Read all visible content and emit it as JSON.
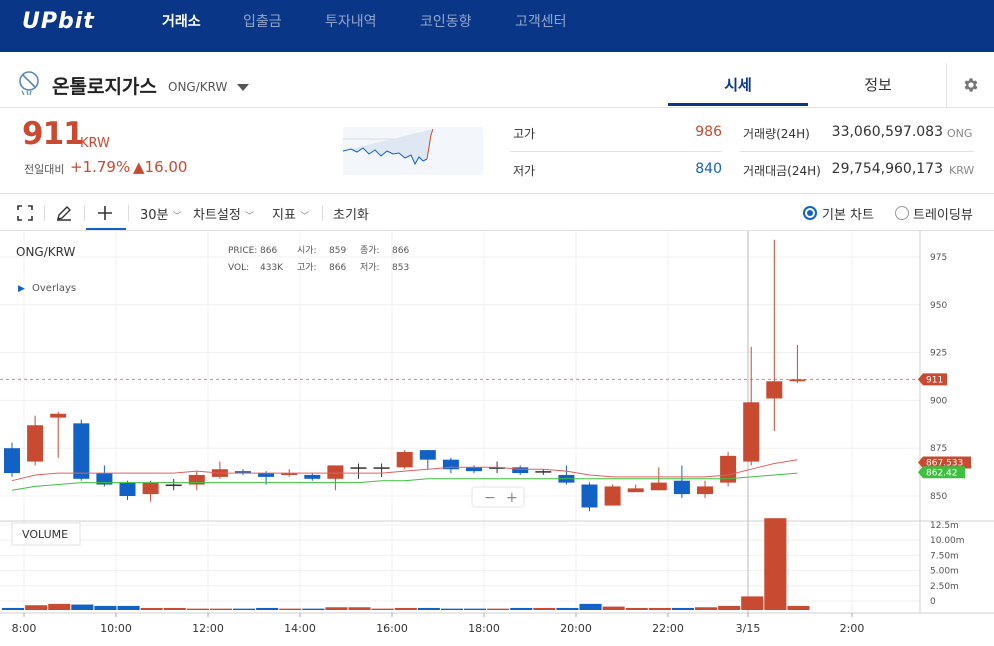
{
  "nav": {
    "logo": "UPbit",
    "items": [
      "거래소",
      "입출금",
      "투자내역",
      "코인동향",
      "고객센터"
    ]
  },
  "coin": {
    "name": "온톨로지가스",
    "pair": "ONG/KRW"
  },
  "tabs": [
    "시세",
    "정보"
  ],
  "price": {
    "current": "911",
    "unit": "KRW",
    "change_label": "전일대비",
    "change_pct": "+1.79%",
    "change_amt": "▲16.00"
  },
  "stats": {
    "high_label": "고가",
    "high_value": "986",
    "low_label": "저가",
    "low_value": "840",
    "volume_label": "거래량(24H)",
    "volume_value": "33,060,597.083",
    "volume_unit": "ONG",
    "amount_label": "거래대금(24H)",
    "amount_value": "29,754,960,173",
    "amount_unit": "KRW"
  },
  "toolbar": {
    "interval": "30분",
    "chart_settings": "차트설정",
    "indicators": "지표",
    "reset": "초기화",
    "basic_chart": "기본 차트",
    "tradingview": "트레이딩뷰"
  },
  "chart_info": {
    "symbol": "ONG/KRW",
    "overlays": "Overlays",
    "price_label": "PRICE:",
    "price_val": "866",
    "open_label": "시가:",
    "open_val": "859",
    "close_label": "종가:",
    "close_val": "866",
    "vol_label": "VOL:",
    "vol_val": "433K",
    "high_label": "고가:",
    "high_val": "866",
    "low_label": "저가:",
    "low_val": "853",
    "volume_panel": "VOLUME",
    "zoom_out": "−",
    "zoom_in": "+"
  },
  "colors": {
    "nav_bg": "#093687",
    "up": "#c84a31",
    "down": "#1261c4",
    "ma_fast": "#e06060",
    "ma_slow": "#3fbf3f"
  },
  "chart_data": {
    "type": "candlestick",
    "x_ticks": [
      "8:00",
      "10:00",
      "12:00",
      "14:00",
      "16:00",
      "18:00",
      "20:00",
      "22:00",
      "3/15",
      "2:00"
    ],
    "y_ticks": [
      975,
      950,
      925,
      900,
      875,
      850
    ],
    "vol_ticks": [
      "12.5m",
      "10.00m",
      "7.50m",
      "5.00m",
      "2.50m",
      "0"
    ],
    "price_tags": [
      {
        "label": "911",
        "value": 911,
        "color": "#c84a31"
      },
      {
        "label": "867.533",
        "value": 867.5,
        "color": "#c84a31"
      },
      {
        "label": "862.42",
        "value": 862.4,
        "color": "#3fbf3f"
      }
    ],
    "candles": [
      {
        "o": 875,
        "c": 862,
        "h": 878,
        "l": 860
      },
      {
        "o": 868,
        "c": 887,
        "h": 892,
        "l": 866
      },
      {
        "o": 891,
        "c": 893,
        "h": 894,
        "l": 870
      },
      {
        "o": 888,
        "c": 859,
        "h": 890,
        "l": 858
      },
      {
        "o": 862,
        "c": 856,
        "h": 866,
        "l": 855
      },
      {
        "o": 857,
        "c": 850,
        "h": 858,
        "l": 848
      },
      {
        "o": 851,
        "c": 857,
        "h": 858,
        "l": 847
      },
      {
        "o": 856,
        "c": 856,
        "h": 859,
        "l": 853
      },
      {
        "o": 856,
        "c": 861,
        "h": 863,
        "l": 853
      },
      {
        "o": 860,
        "c": 864,
        "h": 868,
        "l": 859
      },
      {
        "o": 863,
        "c": 862,
        "h": 864,
        "l": 861
      },
      {
        "o": 862,
        "c": 860,
        "h": 863,
        "l": 856
      },
      {
        "o": 861,
        "c": 862,
        "h": 864,
        "l": 860
      },
      {
        "o": 861,
        "c": 859,
        "h": 862,
        "l": 858
      },
      {
        "o": 859,
        "c": 866,
        "h": 866,
        "l": 853
      },
      {
        "o": 865,
        "c": 865,
        "h": 867,
        "l": 859
      },
      {
        "o": 865,
        "c": 865,
        "h": 867,
        "l": 860
      },
      {
        "o": 865,
        "c": 873,
        "h": 874,
        "l": 864
      },
      {
        "o": 874,
        "c": 869,
        "h": 874,
        "l": 864
      },
      {
        "o": 869,
        "c": 864,
        "h": 870,
        "l": 862
      },
      {
        "o": 865,
        "c": 863,
        "h": 866,
        "l": 862
      },
      {
        "o": 865,
        "c": 865,
        "h": 868,
        "l": 862
      },
      {
        "o": 865,
        "c": 862,
        "h": 866,
        "l": 861
      },
      {
        "o": 863,
        "c": 863,
        "h": 864,
        "l": 861
      },
      {
        "o": 861,
        "c": 857,
        "h": 866,
        "l": 856
      },
      {
        "o": 856,
        "c": 844,
        "h": 857,
        "l": 842
      },
      {
        "o": 845,
        "c": 855,
        "h": 856,
        "l": 845
      },
      {
        "o": 852,
        "c": 854,
        "h": 856,
        "l": 852
      },
      {
        "o": 853,
        "c": 857,
        "h": 865,
        "l": 853
      },
      {
        "o": 858,
        "c": 851,
        "h": 866,
        "l": 849
      },
      {
        "o": 851,
        "c": 855,
        "h": 858,
        "l": 849
      },
      {
        "o": 857,
        "c": 871,
        "h": 873,
        "l": 855
      },
      {
        "o": 868,
        "c": 899,
        "h": 928,
        "l": 866
      },
      {
        "o": 901,
        "c": 910,
        "h": 984,
        "l": 884
      },
      {
        "o": 910,
        "c": 911,
        "h": 929,
        "l": 909
      }
    ],
    "volume_m": [
      0.3,
      0.7,
      0.9,
      0.8,
      0.6,
      0.6,
      0.3,
      0.3,
      0.2,
      0.2,
      0.2,
      0.3,
      0.2,
      0.2,
      0.4,
      0.4,
      0.2,
      0.3,
      0.3,
      0.2,
      0.2,
      0.2,
      0.3,
      0.3,
      0.3,
      0.9,
      0.5,
      0.3,
      0.3,
      0.3,
      0.4,
      0.6,
      2.0,
      13.5,
      0.6
    ],
    "ma_fast": [
      858,
      861,
      862,
      862,
      862,
      862,
      862,
      862,
      863,
      862,
      862,
      862,
      862,
      862,
      862,
      862,
      862,
      863,
      864,
      865,
      865,
      865,
      864,
      864,
      863,
      861,
      860,
      860,
      860,
      860,
      860,
      861,
      864,
      867,
      869
    ],
    "ma_slow": [
      853,
      855,
      856,
      857,
      857,
      857,
      857,
      857,
      857,
      857,
      857,
      857,
      857,
      857,
      857,
      857,
      858,
      858,
      859,
      859,
      859,
      859,
      859,
      859,
      859,
      859,
      859,
      859,
      859,
      859,
      859,
      859,
      860,
      861,
      862
    ]
  }
}
